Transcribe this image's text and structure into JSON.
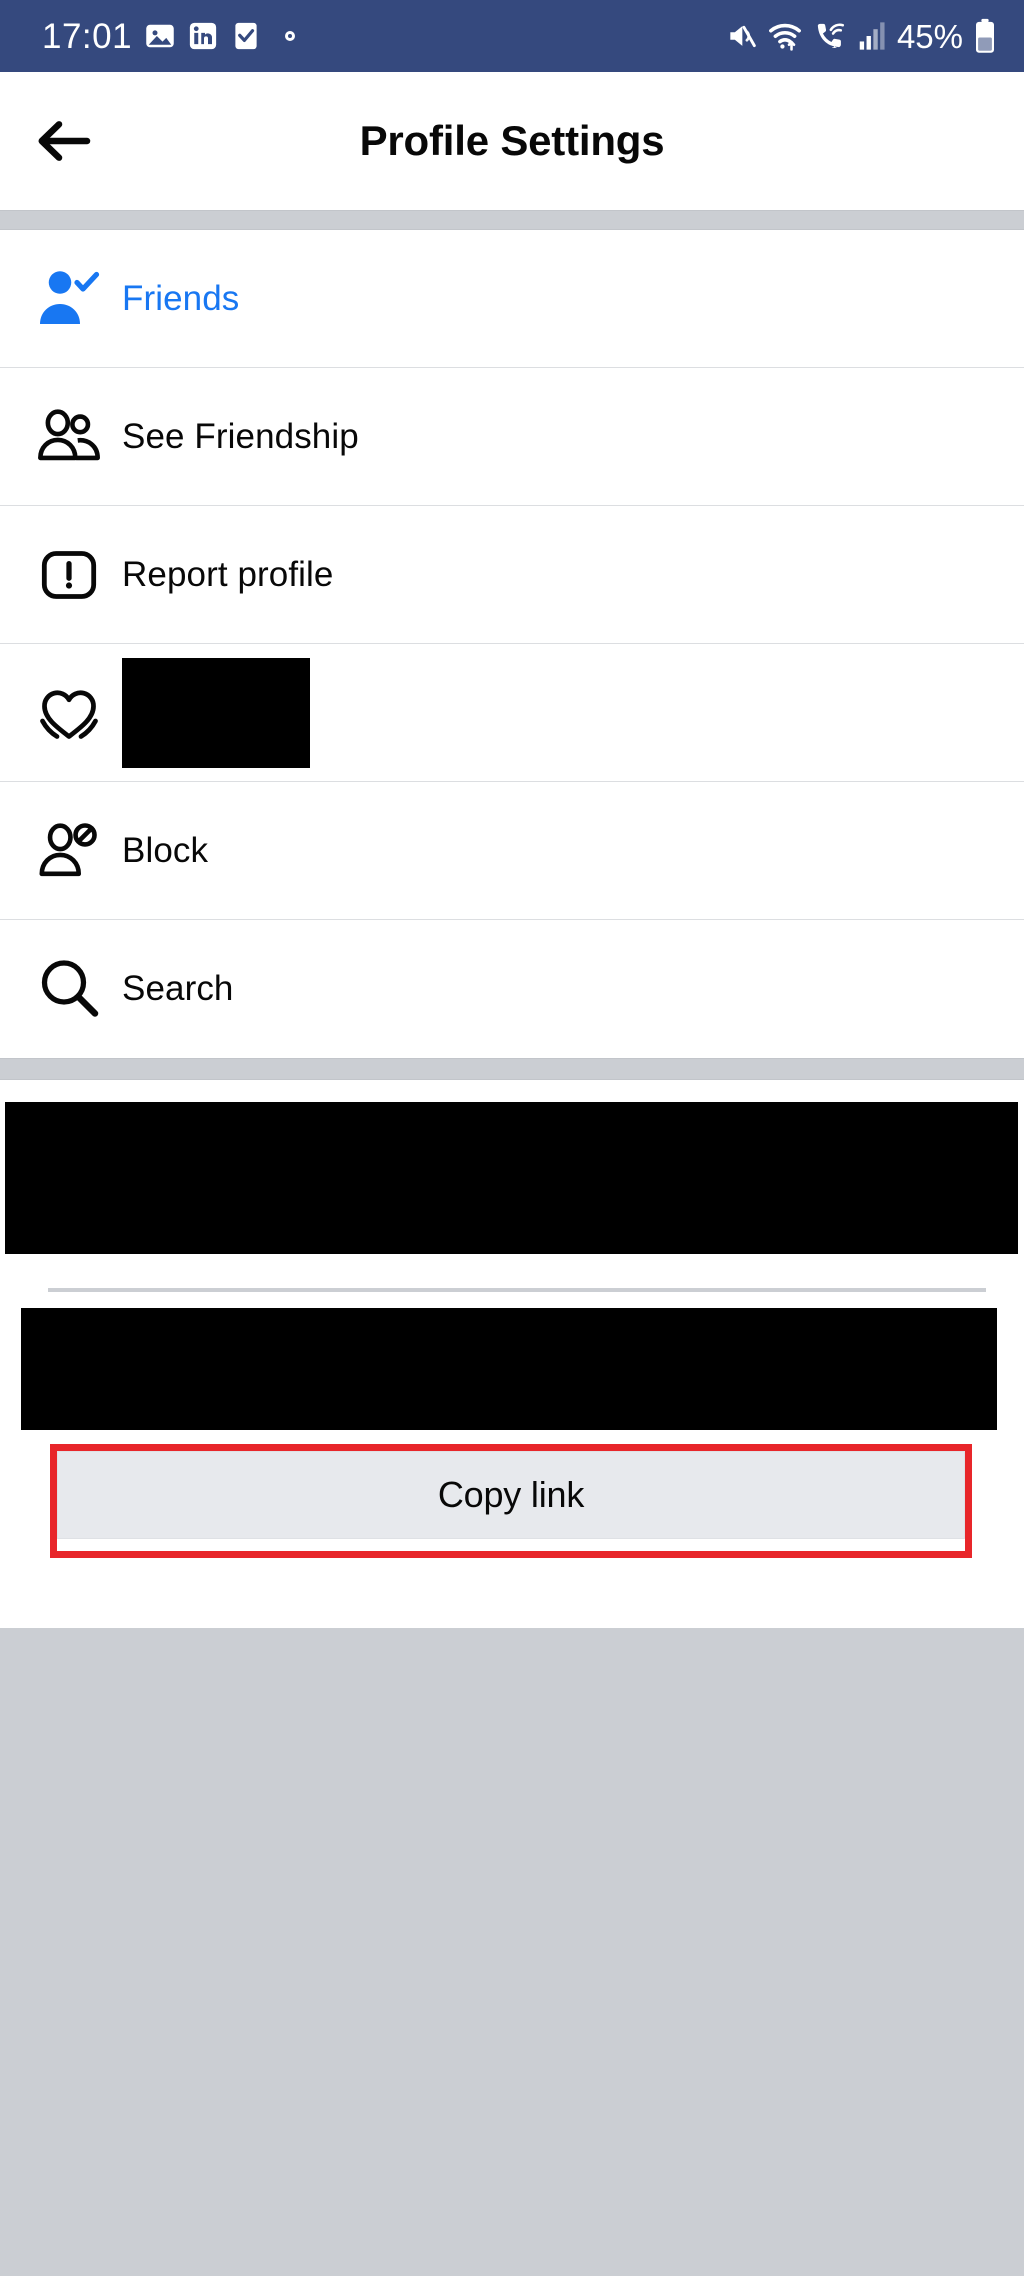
{
  "status_bar": {
    "time": "17:01",
    "battery_percent": "45%",
    "left_icons": [
      "photos-icon",
      "linkedin-icon",
      "tasks-checkbox-icon",
      "dot-indicator-icon"
    ],
    "right_icons": [
      "mute-icon",
      "wifi-icon",
      "wifi-calling-icon",
      "signal-bars-icon"
    ],
    "background_color": "#35497E"
  },
  "header": {
    "back_label": "back-arrow",
    "title": "Profile Settings"
  },
  "menu": {
    "items": [
      {
        "label": "Friends",
        "icon": "person-check-icon",
        "accent": true,
        "redacted": false
      },
      {
        "label": "See Friendship",
        "icon": "two-people-icon",
        "accent": false,
        "redacted": false
      },
      {
        "label": "Report profile",
        "icon": "exclamation-box-icon",
        "accent": false,
        "redacted": false
      },
      {
        "label": "",
        "icon": "heart-icon",
        "accent": false,
        "redacted": true
      },
      {
        "label": "Block",
        "icon": "person-block-icon",
        "accent": false,
        "redacted": false
      },
      {
        "label": "Search",
        "icon": "search-icon",
        "accent": false,
        "redacted": false
      }
    ]
  },
  "share_section": {
    "redacted_block_1": "",
    "redacted_block_2": "",
    "copy_link_label": "Copy link",
    "highlight_color": "#E8262A"
  },
  "colors": {
    "accent_blue": "#1877F2",
    "status_bar_blue": "#35497E",
    "band_gray": "#CBCED3",
    "button_gray": "#E7E9ED",
    "divider_gray": "#DCDEE1",
    "text_dark": "#080808"
  }
}
